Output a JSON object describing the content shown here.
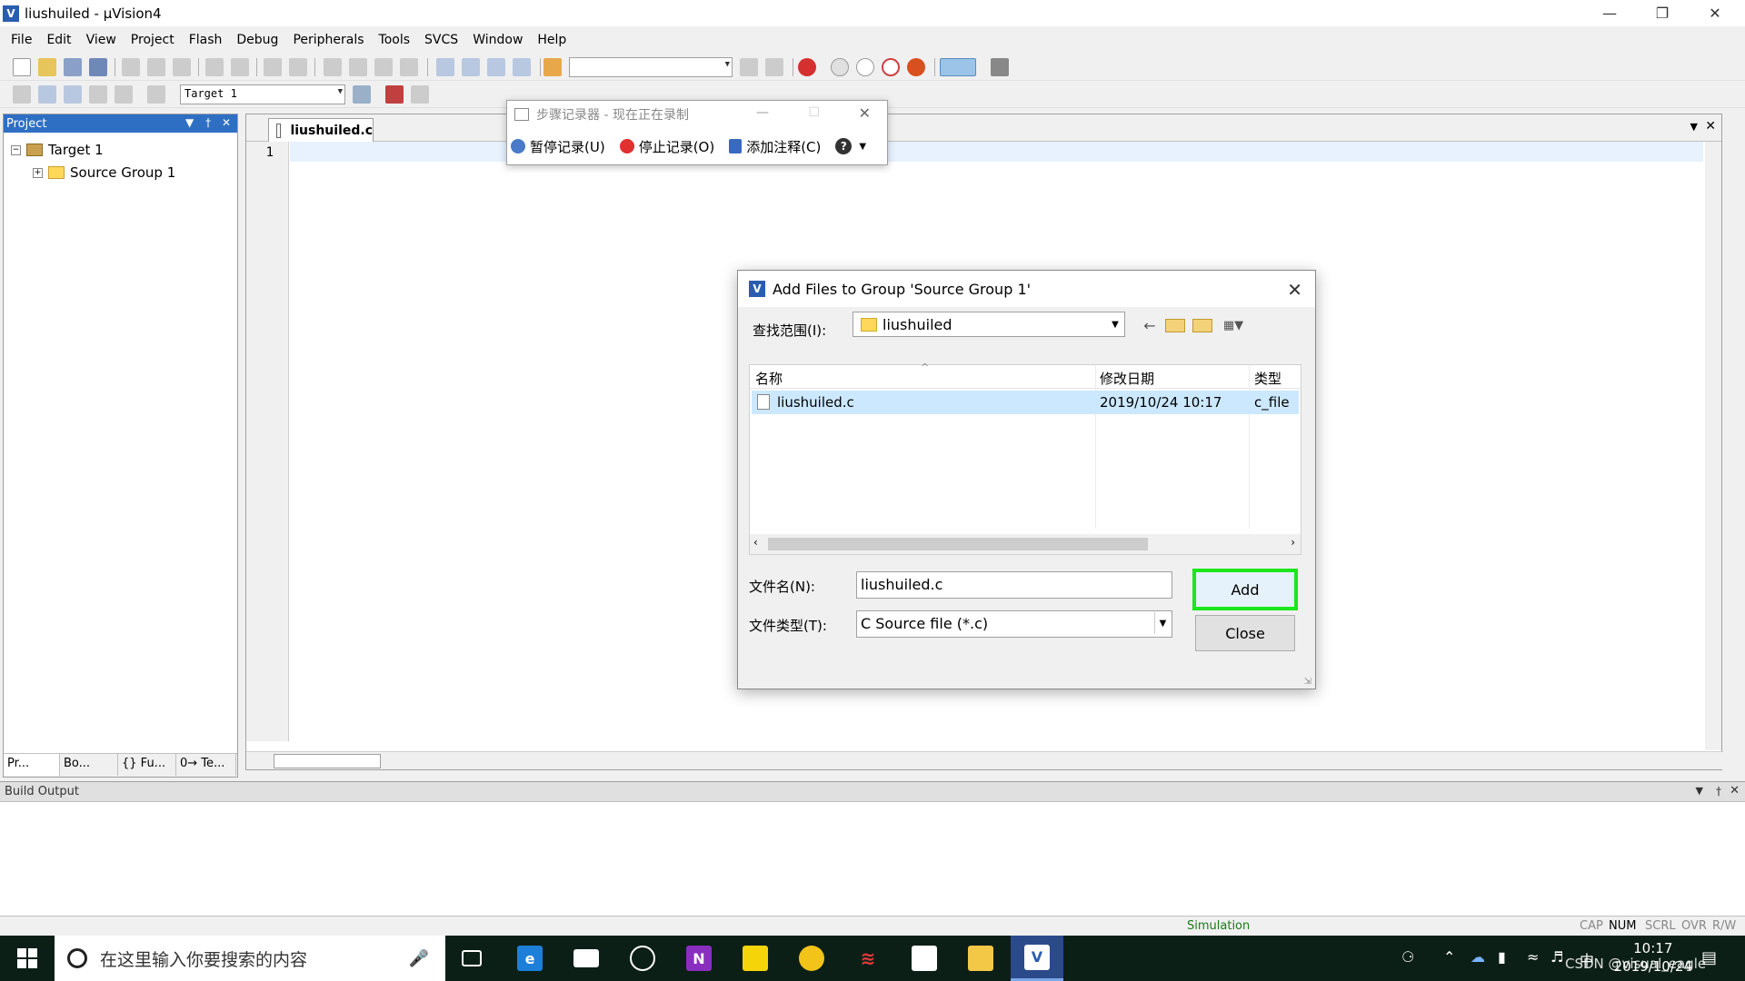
{
  "window": {
    "title": "liushuiled - µVision4",
    "app_icon": "V"
  },
  "menu": [
    "File",
    "Edit",
    "View",
    "Project",
    "Flash",
    "Debug",
    "Peripherals",
    "Tools",
    "SVCS",
    "Window",
    "Help"
  ],
  "toolbar": {
    "target_combo": "Target 1"
  },
  "project_panel": {
    "title": "Project",
    "tree": {
      "root": "Target 1",
      "group": "Source Group 1"
    },
    "tabs": [
      "Pr...",
      "Bo...",
      "{} Fu...",
      "0→ Te..."
    ]
  },
  "editor": {
    "tab_label": "liushuiled.c",
    "line_numbers": [
      "1"
    ]
  },
  "steps_recorder": {
    "title": "步骤记录器 - 现在正在录制",
    "pause": "暂停记录(U)",
    "stop": "停止记录(O)",
    "comment": "添加注释(C)",
    "help": "?"
  },
  "dialog": {
    "title": "Add Files to Group 'Source Group 1'",
    "lookin_label": "查找范围(I):",
    "lookin_value": "liushuiled",
    "columns": {
      "name": "名称",
      "date": "修改日期",
      "type": "类型"
    },
    "files": [
      {
        "name": "liushuiled.c",
        "date": "2019/10/24 10:17",
        "type": "c_file"
      }
    ],
    "filename_label": "文件名(N):",
    "filename_value": "liushuiled.c",
    "filetype_label": "文件类型(T):",
    "filetype_value": "C Source file (*.c)",
    "add_label": "Add",
    "close_label": "Close",
    "highlight_color": "#1ce61c"
  },
  "build_output": {
    "title": "Build Output"
  },
  "statusbar": {
    "mode": "Simulation",
    "indicators": [
      "CAP",
      "NUM",
      "SCRL",
      "OVR",
      "R/W"
    ]
  },
  "taskbar": {
    "search_placeholder": "在这里输入你要搜索的内容",
    "time": "10:17",
    "date": "2019/10/24",
    "ime": "中",
    "watermark": "CSDN @visual_eagle",
    "apps": [
      "task-view",
      "edge",
      "mail",
      "game",
      "onenote",
      "sticky-notes",
      "chrome",
      "wps",
      "store",
      "file-explorer",
      "uvision"
    ]
  }
}
